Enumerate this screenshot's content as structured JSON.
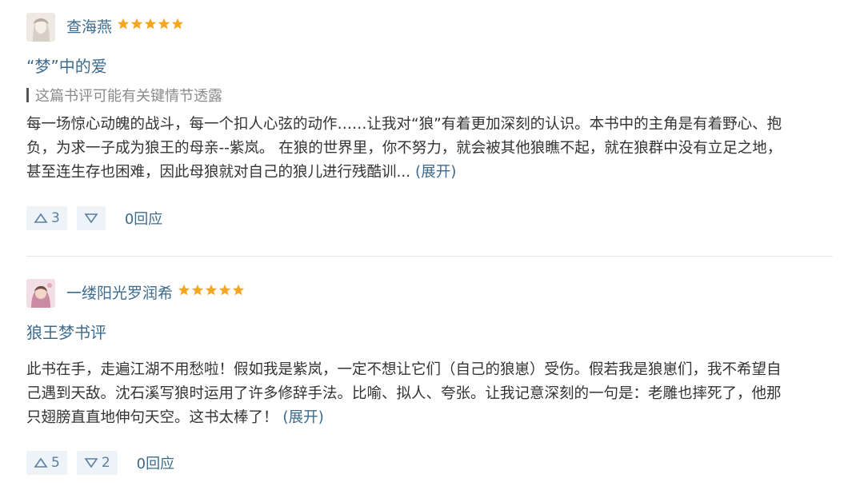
{
  "reviews": [
    {
      "username": "查海燕",
      "rating": 5,
      "title": "“梦”中的爱",
      "spoiler_notice": "这篇书评可能有关键情节透露",
      "lines": [
        "每一场惊心动魄的战斗，每一个扣人心弦的动作……让我对“狼”有着更加深刻的认识。本书中的主角是有着野心、抱",
        "负，为求一子成为狼王的母亲--紫岚。 在狼的世界里，你不努力，就会被其他狼瞧不起，就在狼群中没有立足之地，",
        "甚至连生存也困难，因此母狼就对自己的狼儿进行残酷训..."
      ],
      "expand_label": "(展开)",
      "upvotes": "3",
      "downvotes": "",
      "reply_label": "0回应"
    },
    {
      "username": "一缕阳光罗润希",
      "rating": 5,
      "title": "狼王梦书评",
      "lines": [
        "此书在手，走遍江湖不用愁啦！假如我是紫岚，一定不想让它们（自己的狼崽）受伤。假若我是狼崽们，我不希望自",
        "己遇到天敌。沈石溪写狼时运用了许多修辞手法。比喻、拟人、夸张。让我记意深刻的一句是：老雕也摔死了，他那",
        "只翅膀直直地伸句天空。这书太棒了！"
      ],
      "expand_label": "(展开)",
      "upvotes": "5",
      "downvotes": "2",
      "reply_label": "0回应"
    }
  ],
  "colors": {
    "link": "#3d6b8e",
    "star": "#f5a623",
    "vote_bg": "#eef3f8"
  }
}
